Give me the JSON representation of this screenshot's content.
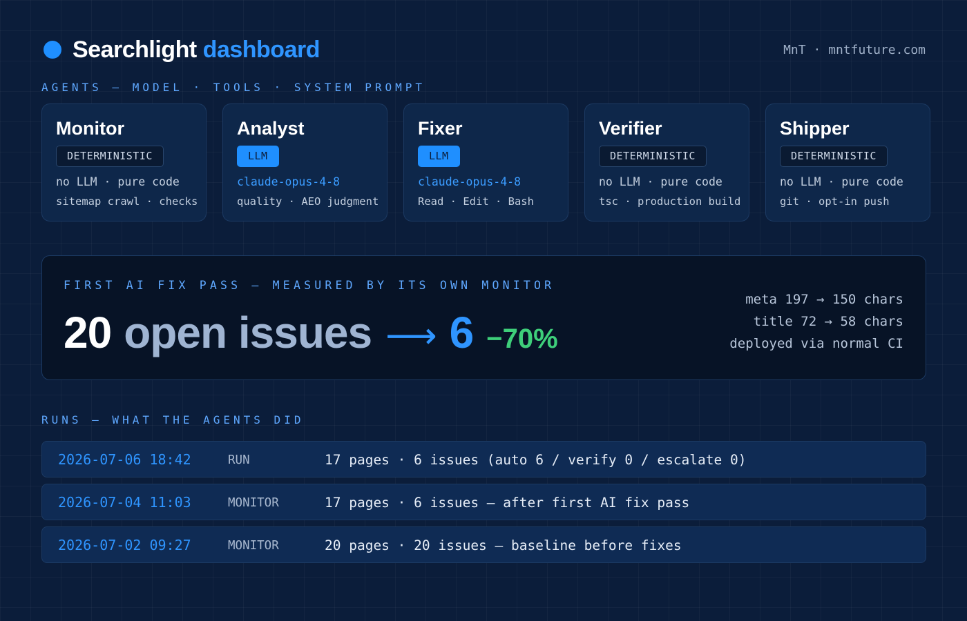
{
  "header": {
    "title_main": "Searchlight",
    "title_accent": "dashboard",
    "byline": "MnT · mntfuture.com"
  },
  "sections": {
    "agents_label": "AGENTS — MODEL · TOOLS · SYSTEM PROMPT",
    "runs_label": "RUNS — WHAT THE AGENTS DID"
  },
  "agents": [
    {
      "name": "Monitor",
      "badge": "DETERMINISTIC",
      "model": "no LLM · pure code",
      "tools": "sitemap crawl · checks"
    },
    {
      "name": "Analyst",
      "badge": "LLM",
      "model": "claude-opus-4-8",
      "tools": "quality · AEO judgment"
    },
    {
      "name": "Fixer",
      "badge": "LLM",
      "model": "claude-opus-4-8",
      "tools": "Read · Edit · Bash"
    },
    {
      "name": "Verifier",
      "badge": "DETERMINISTIC",
      "model": "no LLM · pure code",
      "tools": "tsc · production build"
    },
    {
      "name": "Shipper",
      "badge": "DETERMINISTIC",
      "model": "no LLM · pure code",
      "tools": "git · opt-in push"
    }
  ],
  "hero": {
    "label": "FIRST AI FIX PASS — MEASURED BY ITS OWN MONITOR",
    "before": "20",
    "unit": "open issues",
    "arrow": "⟶",
    "after": "6",
    "delta": "−70%",
    "facts": [
      "meta 197 → 150 chars",
      "title 72 → 58 chars",
      "deployed via normal CI"
    ]
  },
  "runs": [
    {
      "time": "2026-07-06 18:42",
      "type": "RUN",
      "desc": "17 pages · 6 issues (auto 6 / verify 0 / escalate 0)"
    },
    {
      "time": "2026-07-04 11:03",
      "type": "MONITOR",
      "desc": "17 pages · 6 issues — after first AI fix pass"
    },
    {
      "time": "2026-07-02 09:27",
      "type": "MONITOR",
      "desc": "20 pages · 20 issues — baseline before fixes"
    }
  ],
  "colors": {
    "background": "#0b1d3a",
    "accent": "#2f95ff",
    "success": "#3ecf7a"
  }
}
